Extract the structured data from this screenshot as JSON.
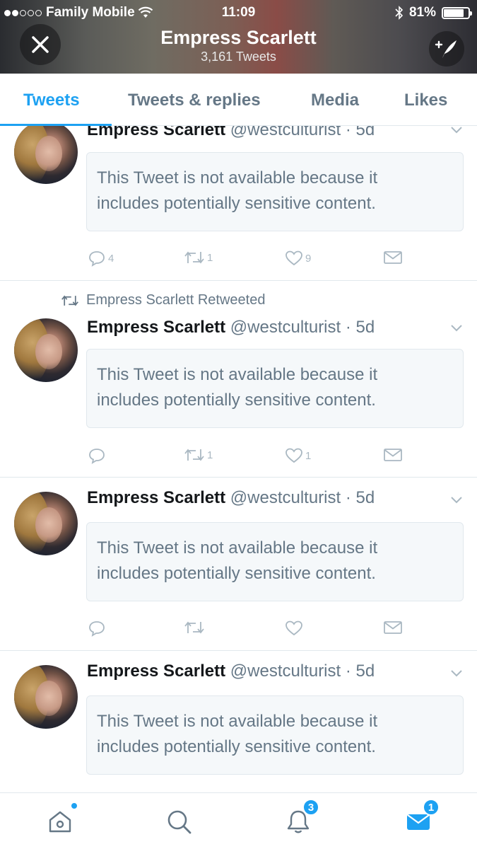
{
  "status_bar": {
    "carrier": "Family Mobile",
    "time": "11:09",
    "battery": "81%",
    "battery_level": 0.81
  },
  "header": {
    "profile_name": "Empress Scarlett",
    "tweet_count": "3,161 Tweets"
  },
  "tabs": [
    {
      "label": "Tweets",
      "active": true
    },
    {
      "label": "Tweets & replies",
      "active": false
    },
    {
      "label": "Media",
      "active": false
    },
    {
      "label": "Likes",
      "active": false
    }
  ],
  "tweets": [
    {
      "name": "Empress Scarlett",
      "handle": "@westculturist",
      "time": "5d",
      "notice": [
        "This Tweet is not available because it",
        "includes potentially sensitive content."
      ],
      "reply_count": "4",
      "retweet_count": "1",
      "like_count": "9"
    },
    {
      "retweeted_by": "Empress Scarlett Retweeted",
      "name": "Empress Scarlett",
      "handle": "@westculturist",
      "time": "5d",
      "notice": [
        "This Tweet is not available because it",
        "includes potentially sensitive content."
      ],
      "reply_count": "",
      "retweet_count": "1",
      "like_count": "1"
    },
    {
      "name": "Empress Scarlett",
      "handle": "@westculturist",
      "time": "5d",
      "notice": [
        "This Tweet is not available because it",
        "includes potentially sensitive content."
      ],
      "reply_count": "",
      "retweet_count": "",
      "like_count": ""
    },
    {
      "name": "Empress Scarlett",
      "handle": "@westculturist",
      "time": "5d",
      "notice": [
        "This Tweet is not available because it",
        "includes potentially sensitive content."
      ]
    }
  ],
  "bottom_nav": {
    "items": [
      "home-icon",
      "search-icon",
      "notifications-icon",
      "messages-icon"
    ],
    "notifications_badge": "3",
    "messages_badge": "1"
  },
  "colors": {
    "accent": "#1da1f2",
    "muted_text": "#657786",
    "icon_gray": "#aab8c2",
    "notice_bg": "#f5f8fa"
  }
}
